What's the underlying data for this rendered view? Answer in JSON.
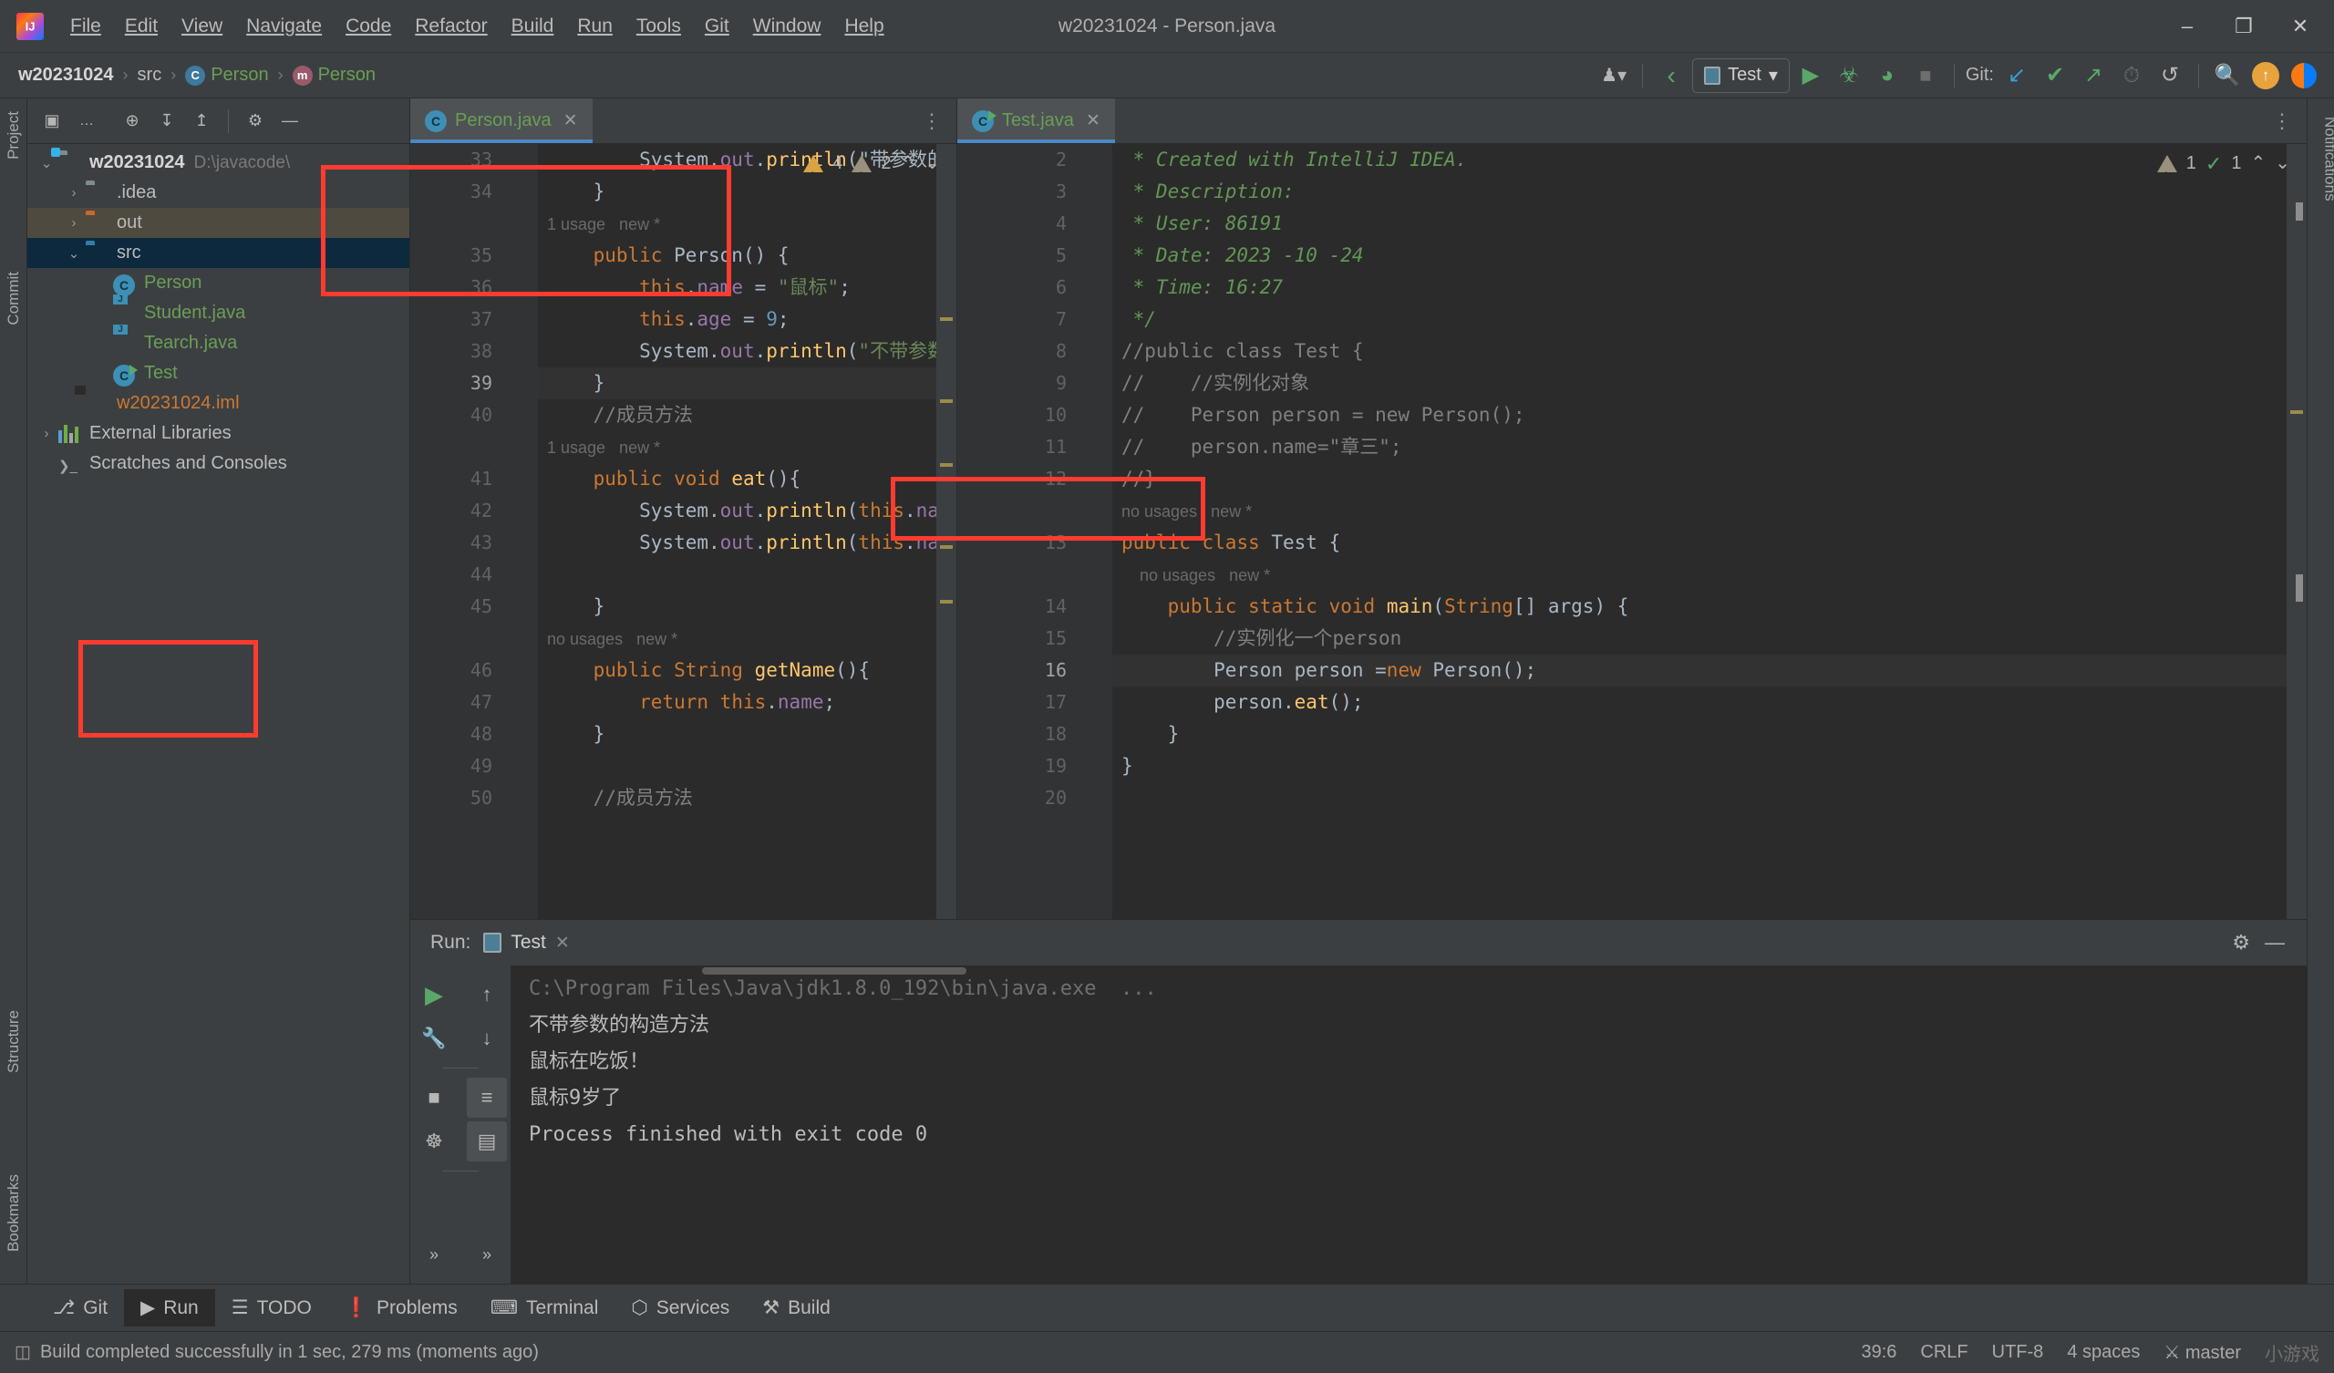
{
  "window": {
    "title": "w20231024 - Person.java",
    "minimize": "–",
    "restore": "❐",
    "close": "✕"
  },
  "menubar": [
    {
      "label": "File"
    },
    {
      "label": "Edit"
    },
    {
      "label": "View"
    },
    {
      "label": "Navigate"
    },
    {
      "label": "Code"
    },
    {
      "label": "Refactor"
    },
    {
      "label": "Build"
    },
    {
      "label": "Run"
    },
    {
      "label": "Tools"
    },
    {
      "label": "Git"
    },
    {
      "label": "Window"
    },
    {
      "label": "Help"
    }
  ],
  "breadcrumbs": {
    "project": "w20231024",
    "folder": "src",
    "class": "Person",
    "class_badge": "C",
    "method": "Person",
    "method_badge": "m",
    "sep": "›"
  },
  "toolbar": {
    "run_config": "Test",
    "run_config_caret": "▾",
    "git_label": "Git:",
    "icons": [
      {
        "name": "user-avatar-icon",
        "glyph": "♟"
      },
      {
        "name": "back-arrow-icon",
        "glyph": "‹"
      },
      {
        "name": "run-icon",
        "glyph": "▶"
      },
      {
        "name": "debug-icon",
        "glyph": "☣"
      },
      {
        "name": "run-coverage-icon",
        "glyph": "◗"
      },
      {
        "name": "stop-icon",
        "glyph": "■"
      },
      {
        "name": "git-update-icon",
        "glyph": "↙"
      },
      {
        "name": "git-commit-icon",
        "glyph": "✔"
      },
      {
        "name": "git-push-icon",
        "glyph": "↗"
      },
      {
        "name": "history-icon",
        "glyph": "◴"
      },
      {
        "name": "undo-icon",
        "glyph": "↺"
      },
      {
        "name": "search-everywhere-icon",
        "glyph": "⚲"
      }
    ]
  },
  "left_strips": {
    "project": "Project",
    "commit": "Commit",
    "structure": "Structure",
    "bookmarks": "Bookmarks",
    "notifications": "Notifications"
  },
  "project_panel": {
    "toolbar_icons": [
      {
        "name": "project-view-select-icon",
        "glyph": "▣"
      },
      {
        "name": "ellipsis-icon",
        "glyph": "..."
      },
      {
        "name": "scroll-from-source-icon",
        "glyph": "⊕"
      },
      {
        "name": "expand-all-icon",
        "glyph": "↧"
      },
      {
        "name": "collapse-all-icon",
        "glyph": "↥"
      },
      {
        "name": "settings-gear-icon",
        "glyph": "⚙"
      },
      {
        "name": "hide-panel-icon",
        "glyph": "—"
      }
    ],
    "tree": [
      {
        "label": "w20231024",
        "path": "D:\\javacode\\",
        "indent": 0,
        "arrow": "⌄",
        "icon": "module-folder-icon",
        "style": "bold",
        "selected": null
      },
      {
        "label": ".idea",
        "path": "",
        "indent": 1,
        "arrow": "›",
        "icon": "folder-gray-icon",
        "style": "",
        "selected": null
      },
      {
        "label": "out",
        "path": "",
        "indent": 1,
        "arrow": "›",
        "icon": "folder-orange-icon",
        "style": "",
        "selected": "out"
      },
      {
        "label": "src",
        "path": "",
        "indent": 1,
        "arrow": "⌄",
        "icon": "folder-blue-icon",
        "style": "",
        "selected": "src"
      },
      {
        "label": "Person",
        "path": "",
        "indent": 2,
        "arrow": "",
        "icon": "class-icon",
        "style": "green",
        "selected": null
      },
      {
        "label": "Student.java",
        "path": "",
        "indent": 2,
        "arrow": "",
        "icon": "java-file-icon",
        "style": "green",
        "selected": null
      },
      {
        "label": "Tearch.java",
        "path": "",
        "indent": 2,
        "arrow": "",
        "icon": "java-file-icon",
        "style": "green",
        "selected": null
      },
      {
        "label": "Test",
        "path": "",
        "indent": 2,
        "arrow": "",
        "icon": "runnable-class-icon",
        "style": "green",
        "selected": null
      },
      {
        "label": "w20231024.iml",
        "path": "",
        "indent": 1,
        "arrow": "",
        "icon": "iml-file-icon",
        "style": "red",
        "selected": null
      },
      {
        "label": "External Libraries",
        "path": "",
        "indent": 0,
        "arrow": "›",
        "icon": "libraries-icon",
        "style": "",
        "selected": null
      },
      {
        "label": "Scratches and Consoles",
        "path": "",
        "indent": 0,
        "arrow": "",
        "icon": "scratches-icon",
        "style": "",
        "selected": null
      }
    ]
  },
  "editor_left": {
    "tab_label": "Person.java",
    "tab_icon": "class-icon",
    "close_glyph": "✕",
    "inspections": {
      "warnings": "4",
      "weak_warnings": "2",
      "up": "⌃",
      "down": "⌄"
    },
    "lines": [
      {
        "num": "33",
        "text": "        System.out.println(\"带参数的构造方",
        "kind": "code"
      },
      {
        "num": "34",
        "text": "    }",
        "kind": "code"
      },
      {
        "num": "",
        "text": "1 usage   new *",
        "kind": "hint"
      },
      {
        "num": "35",
        "text": "    public Person() {",
        "kind": "code"
      },
      {
        "num": "36",
        "text": "        this.name = \"鼠标\";",
        "kind": "code"
      },
      {
        "num": "37",
        "text": "        this.age = 9;",
        "kind": "code"
      },
      {
        "num": "38",
        "text": "        System.out.println(\"不带参数的构造方法\");",
        "kind": "code"
      },
      {
        "num": "39",
        "text": "    }",
        "kind": "code"
      },
      {
        "num": "40",
        "text": "    //成员方法",
        "kind": "code"
      },
      {
        "num": "",
        "text": "1 usage   new *",
        "kind": "hint"
      },
      {
        "num": "41",
        "text": "    public void eat(){",
        "kind": "code"
      },
      {
        "num": "42",
        "text": "        System.out.println(this.name+\"在吃饭！\");",
        "kind": "code"
      },
      {
        "num": "43",
        "text": "        System.out.println(this.name+this.age+\"岁了\");",
        "kind": "code"
      },
      {
        "num": "44",
        "text": "",
        "kind": "code"
      },
      {
        "num": "45",
        "text": "    }",
        "kind": "code"
      },
      {
        "num": "",
        "text": "no usages   new *",
        "kind": "hint"
      },
      {
        "num": "46",
        "text": "    public String getName(){",
        "kind": "code"
      },
      {
        "num": "47",
        "text": "        return this.name;",
        "kind": "code"
      },
      {
        "num": "48",
        "text": "    }",
        "kind": "code"
      },
      {
        "num": "49",
        "text": "",
        "kind": "code"
      },
      {
        "num": "50",
        "text": "    //成员方法",
        "kind": "code"
      }
    ]
  },
  "editor_right": {
    "tab_label": "Test.java",
    "tab_icon": "runnable-class-icon",
    "close_glyph": "✕",
    "inspections": {
      "weak_warnings": "1",
      "checks": "1",
      "up": "⌃",
      "down": "⌄"
    },
    "lines": [
      {
        "num": "2",
        "text": " * Created with IntelliJ IDEA.",
        "kind": "doc"
      },
      {
        "num": "3",
        "text": " * Description:",
        "kind": "doc"
      },
      {
        "num": "4",
        "text": " * User: 86191",
        "kind": "doc"
      },
      {
        "num": "5",
        "text": " * Date: 2023 -10 -24",
        "kind": "doc"
      },
      {
        "num": "6",
        "text": " * Time: 16:27",
        "kind": "doc"
      },
      {
        "num": "7",
        "text": " */",
        "kind": "doc"
      },
      {
        "num": "8",
        "text": "//public class Test {",
        "kind": "comment"
      },
      {
        "num": "9",
        "text": "//    //实例化对象",
        "kind": "comment"
      },
      {
        "num": "10",
        "text": "//    Person person = new Person();",
        "kind": "comment"
      },
      {
        "num": "11",
        "text": "//    person.name=\"章三\";",
        "kind": "comment"
      },
      {
        "num": "12",
        "text": "//}",
        "kind": "comment"
      },
      {
        "num": "",
        "text": "no usages   new *",
        "kind": "hint"
      },
      {
        "num": "13",
        "text": "public class Test {",
        "kind": "code"
      },
      {
        "num": "",
        "text": "    no usages   new *",
        "kind": "hint"
      },
      {
        "num": "14",
        "text": "    public static void main(String[] args) {",
        "kind": "code"
      },
      {
        "num": "15",
        "text": "        //实例化一个person",
        "kind": "code"
      },
      {
        "num": "16",
        "text": "        Person person =new Person();",
        "kind": "code"
      },
      {
        "num": "17",
        "text": "        person.eat();",
        "kind": "code"
      },
      {
        "num": "18",
        "text": "    }",
        "kind": "code"
      },
      {
        "num": "19",
        "text": "}",
        "kind": "code"
      },
      {
        "num": "20",
        "text": "",
        "kind": "code"
      }
    ]
  },
  "run_panel": {
    "label": "Run:",
    "tab_name": "Test",
    "tab_close": "✕",
    "settings_icon": "⚙",
    "hide_icon": "—",
    "gutter_icons": [
      {
        "name": "rerun-icon",
        "glyph": "▶"
      },
      {
        "name": "scroll-up-icon",
        "glyph": "↑"
      },
      {
        "name": "wrench-icon",
        "glyph": "ὒ7"
      },
      {
        "name": "scroll-down-icon",
        "glyph": "↓"
      },
      {
        "name": "stop-icon",
        "glyph": "■"
      },
      {
        "name": "soft-wrap-icon",
        "glyph": "≡"
      },
      {
        "name": "print-icon",
        "glyph": "☷"
      },
      {
        "name": "clear-all-icon",
        "glyph": "✖"
      }
    ],
    "output": [
      {
        "text": "C:\\Program Files\\Java\\jdk1.8.0_192\\bin\\java.exe  ...",
        "style": "dim"
      },
      {
        "text": "不带参数的构造方法",
        "style": ""
      },
      {
        "text": "鼠标在吃饭！",
        "style": ""
      },
      {
        "text": "鼠标9岁了",
        "style": ""
      },
      {
        "text": "",
        "style": ""
      },
      {
        "text": "Process finished with exit code 0",
        "style": ""
      }
    ]
  },
  "tool_windows": [
    {
      "label": "Git",
      "icon": "git-branch-icon",
      "glyph": "⎇",
      "active": false
    },
    {
      "label": "Run",
      "icon": "run-icon",
      "glyph": "▶",
      "active": true
    },
    {
      "label": "TODO",
      "icon": "todo-list-icon",
      "glyph": "☰",
      "active": false
    },
    {
      "label": "Problems",
      "icon": "problems-icon",
      "glyph": "❗",
      "active": false
    },
    {
      "label": "Terminal",
      "icon": "terminal-icon",
      "glyph": "⌨",
      "active": false
    },
    {
      "label": "Services",
      "icon": "services-icon",
      "glyph": "⬡",
      "active": false
    },
    {
      "label": "Build",
      "icon": "build-hammer-icon",
      "glyph": "⚒",
      "active": false
    }
  ],
  "status_bar": {
    "message": "Build completed successfully in 1 sec, 279 ms (moments ago)",
    "message_icon": "build-status-icon",
    "caret_position": "39:6",
    "line_separator": "CRLF",
    "encoding": "UTF-8",
    "indent": "4 spaces",
    "branch": "master",
    "branch_icon": "git-branch-icon",
    "watermark": "小游戏"
  },
  "annotations": {
    "box1_name": "highlight-box-person-constructor",
    "box2_name": "highlight-box-test-main-body",
    "box3_name": "highlight-box-console-output",
    "color": "#ff3b30"
  }
}
